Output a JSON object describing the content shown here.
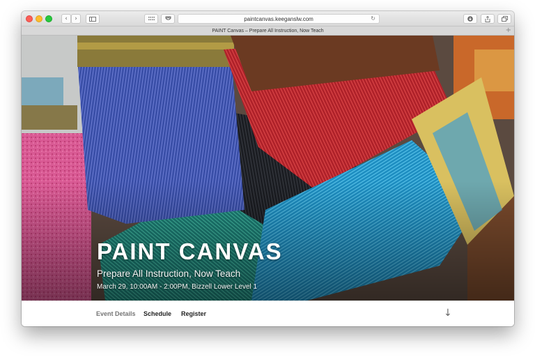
{
  "browser": {
    "url": "paintcanvas.keeganslw.com",
    "tab_title": "PAINT Canvas – Prepare All Instruction, Now Teach",
    "icons": {
      "back": "chevron-left-icon",
      "forward": "chevron-right-icon",
      "sidebar": "sidebar-icon",
      "grid": "grid-icon",
      "shield": "shield-icon",
      "reload": "reload-icon",
      "download": "download-icon",
      "share": "share-icon",
      "tabs": "tabs-icon",
      "new_tab": "plus-icon"
    }
  },
  "hero": {
    "title": "PAINT CANVAS",
    "subtitle": "Prepare All Instruction, Now Teach",
    "details": "March 29, 10:00AM - 2:00PM, Bizzell Lower Level 1"
  },
  "nav": {
    "items": [
      "Event Details",
      "Schedule",
      "Register"
    ],
    "arrow_icon": "arrow-down-icon"
  },
  "colors": {
    "traffic_red": "#fc5f57",
    "traffic_yellow": "#fdbc2e",
    "traffic_green": "#28c840"
  }
}
